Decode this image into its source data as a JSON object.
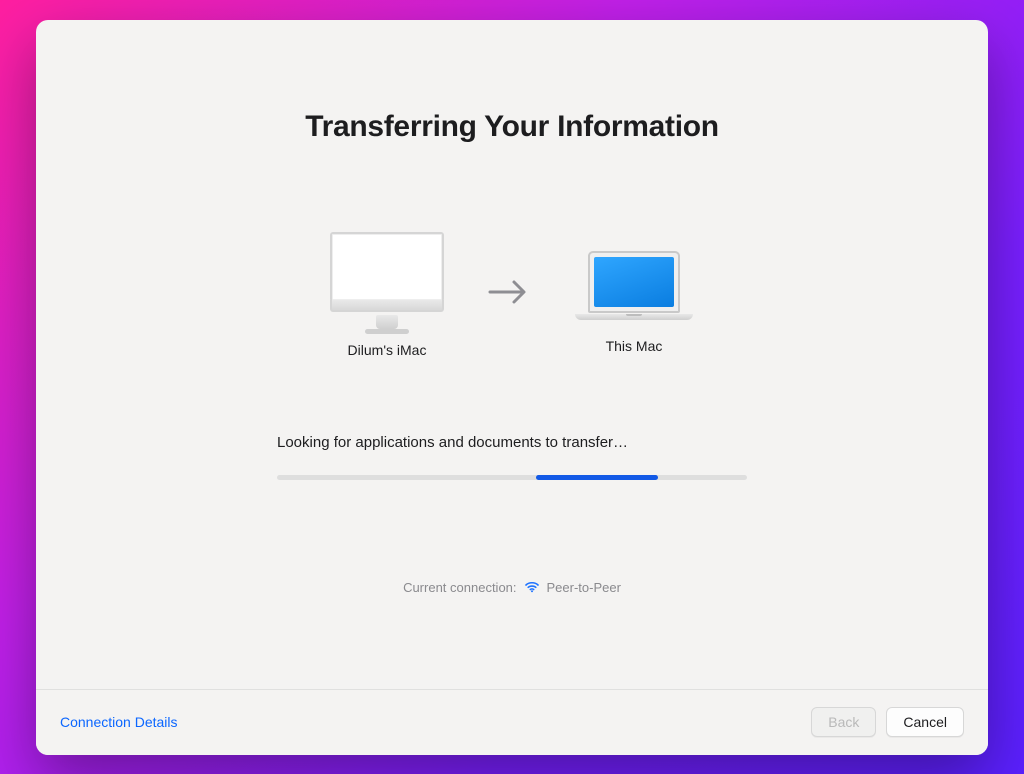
{
  "title": "Transferring Your Information",
  "devices": {
    "source_label": "Dilum's iMac",
    "target_label": "This Mac"
  },
  "status_text": "Looking for applications and documents to transfer…",
  "progress": {
    "indeterminate": true,
    "chunk_start_pct": 55,
    "chunk_width_pct": 26
  },
  "connection": {
    "label": "Current connection:",
    "type": "Peer-to-Peer",
    "icon": "wifi-icon"
  },
  "footer": {
    "details_link": "Connection Details",
    "back_label": "Back",
    "cancel_label": "Cancel",
    "back_enabled": false
  }
}
